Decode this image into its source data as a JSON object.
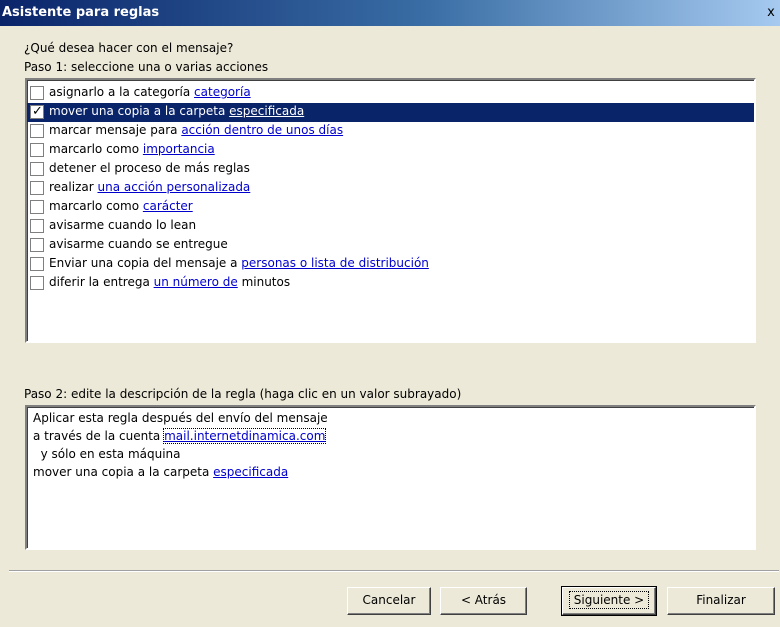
{
  "window": {
    "title": "Asistente para reglas",
    "close_glyph": "x"
  },
  "question": "¿Qué desea hacer con el mensaje?",
  "step1_label": "Paso 1: seleccione una o varias acciones",
  "actions": [
    {
      "checked": false,
      "selected": false,
      "text": "asignarlo a la categoría ",
      "link": "categoría",
      "suffix": ""
    },
    {
      "checked": true,
      "selected": true,
      "text": "mover una copia a la carpeta ",
      "link": "especificada",
      "suffix": ""
    },
    {
      "checked": false,
      "selected": false,
      "text": "marcar mensaje para ",
      "link": "acción dentro de unos días",
      "suffix": ""
    },
    {
      "checked": false,
      "selected": false,
      "text": "marcarlo como ",
      "link": "importancia",
      "suffix": ""
    },
    {
      "checked": false,
      "selected": false,
      "text": "detener el proceso de más reglas",
      "link": "",
      "suffix": ""
    },
    {
      "checked": false,
      "selected": false,
      "text": "realizar ",
      "link": "una acción personalizada",
      "suffix": ""
    },
    {
      "checked": false,
      "selected": false,
      "text": "marcarlo como ",
      "link": "carácter",
      "suffix": ""
    },
    {
      "checked": false,
      "selected": false,
      "text": "avisarme cuando lo lean",
      "link": "",
      "suffix": ""
    },
    {
      "checked": false,
      "selected": false,
      "text": "avisarme cuando se entregue",
      "link": "",
      "suffix": ""
    },
    {
      "checked": false,
      "selected": false,
      "text": "Enviar una copia del mensaje a ",
      "link": "personas o lista de distribución",
      "suffix": ""
    },
    {
      "checked": false,
      "selected": false,
      "text": "diferir la entrega ",
      "link": "un número de",
      "suffix": " minutos"
    }
  ],
  "step2_label": "Paso 2: edite la descripción de la regla (haga clic en un valor subrayado)",
  "description": {
    "line1": "Aplicar esta regla después del envío del mensaje",
    "line2_text": "a través de la cuenta ",
    "line2_link": "mail.internetdinamica.com",
    "line3": "  y sólo en esta máquina",
    "line4_text": "mover una copia a la carpeta ",
    "line4_link": "especificada"
  },
  "buttons": {
    "cancel": "Cancelar",
    "back": "< Atrás",
    "next": "Siguiente >",
    "finish": "Finalizar"
  }
}
